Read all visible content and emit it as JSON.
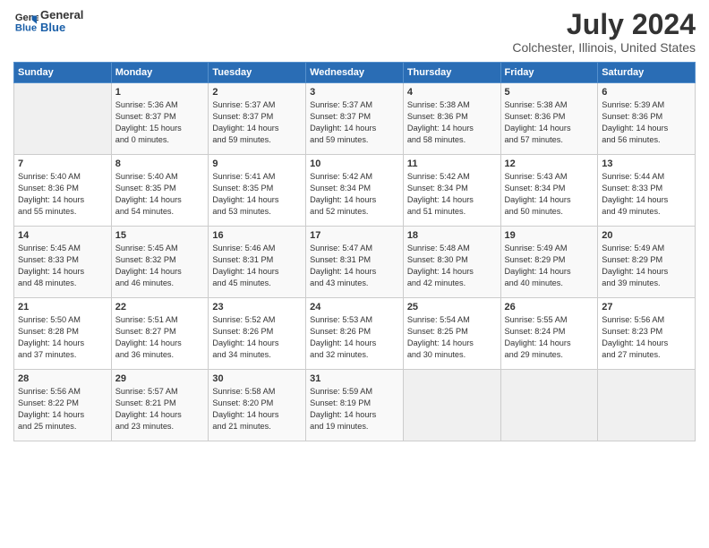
{
  "header": {
    "logo_general": "General",
    "logo_blue": "Blue",
    "title": "July 2024",
    "subtitle": "Colchester, Illinois, United States"
  },
  "days_of_week": [
    "Sunday",
    "Monday",
    "Tuesday",
    "Wednesday",
    "Thursday",
    "Friday",
    "Saturday"
  ],
  "weeks": [
    {
      "days": [
        {
          "number": "",
          "data": ""
        },
        {
          "number": "1",
          "data": "Sunrise: 5:36 AM\nSunset: 8:37 PM\nDaylight: 15 hours\nand 0 minutes."
        },
        {
          "number": "2",
          "data": "Sunrise: 5:37 AM\nSunset: 8:37 PM\nDaylight: 14 hours\nand 59 minutes."
        },
        {
          "number": "3",
          "data": "Sunrise: 5:37 AM\nSunset: 8:37 PM\nDaylight: 14 hours\nand 59 minutes."
        },
        {
          "number": "4",
          "data": "Sunrise: 5:38 AM\nSunset: 8:36 PM\nDaylight: 14 hours\nand 58 minutes."
        },
        {
          "number": "5",
          "data": "Sunrise: 5:38 AM\nSunset: 8:36 PM\nDaylight: 14 hours\nand 57 minutes."
        },
        {
          "number": "6",
          "data": "Sunrise: 5:39 AM\nSunset: 8:36 PM\nDaylight: 14 hours\nand 56 minutes."
        }
      ]
    },
    {
      "days": [
        {
          "number": "7",
          "data": "Sunrise: 5:40 AM\nSunset: 8:36 PM\nDaylight: 14 hours\nand 55 minutes."
        },
        {
          "number": "8",
          "data": "Sunrise: 5:40 AM\nSunset: 8:35 PM\nDaylight: 14 hours\nand 54 minutes."
        },
        {
          "number": "9",
          "data": "Sunrise: 5:41 AM\nSunset: 8:35 PM\nDaylight: 14 hours\nand 53 minutes."
        },
        {
          "number": "10",
          "data": "Sunrise: 5:42 AM\nSunset: 8:34 PM\nDaylight: 14 hours\nand 52 minutes."
        },
        {
          "number": "11",
          "data": "Sunrise: 5:42 AM\nSunset: 8:34 PM\nDaylight: 14 hours\nand 51 minutes."
        },
        {
          "number": "12",
          "data": "Sunrise: 5:43 AM\nSunset: 8:34 PM\nDaylight: 14 hours\nand 50 minutes."
        },
        {
          "number": "13",
          "data": "Sunrise: 5:44 AM\nSunset: 8:33 PM\nDaylight: 14 hours\nand 49 minutes."
        }
      ]
    },
    {
      "days": [
        {
          "number": "14",
          "data": "Sunrise: 5:45 AM\nSunset: 8:33 PM\nDaylight: 14 hours\nand 48 minutes."
        },
        {
          "number": "15",
          "data": "Sunrise: 5:45 AM\nSunset: 8:32 PM\nDaylight: 14 hours\nand 46 minutes."
        },
        {
          "number": "16",
          "data": "Sunrise: 5:46 AM\nSunset: 8:31 PM\nDaylight: 14 hours\nand 45 minutes."
        },
        {
          "number": "17",
          "data": "Sunrise: 5:47 AM\nSunset: 8:31 PM\nDaylight: 14 hours\nand 43 minutes."
        },
        {
          "number": "18",
          "data": "Sunrise: 5:48 AM\nSunset: 8:30 PM\nDaylight: 14 hours\nand 42 minutes."
        },
        {
          "number": "19",
          "data": "Sunrise: 5:49 AM\nSunset: 8:29 PM\nDaylight: 14 hours\nand 40 minutes."
        },
        {
          "number": "20",
          "data": "Sunrise: 5:49 AM\nSunset: 8:29 PM\nDaylight: 14 hours\nand 39 minutes."
        }
      ]
    },
    {
      "days": [
        {
          "number": "21",
          "data": "Sunrise: 5:50 AM\nSunset: 8:28 PM\nDaylight: 14 hours\nand 37 minutes."
        },
        {
          "number": "22",
          "data": "Sunrise: 5:51 AM\nSunset: 8:27 PM\nDaylight: 14 hours\nand 36 minutes."
        },
        {
          "number": "23",
          "data": "Sunrise: 5:52 AM\nSunset: 8:26 PM\nDaylight: 14 hours\nand 34 minutes."
        },
        {
          "number": "24",
          "data": "Sunrise: 5:53 AM\nSunset: 8:26 PM\nDaylight: 14 hours\nand 32 minutes."
        },
        {
          "number": "25",
          "data": "Sunrise: 5:54 AM\nSunset: 8:25 PM\nDaylight: 14 hours\nand 30 minutes."
        },
        {
          "number": "26",
          "data": "Sunrise: 5:55 AM\nSunset: 8:24 PM\nDaylight: 14 hours\nand 29 minutes."
        },
        {
          "number": "27",
          "data": "Sunrise: 5:56 AM\nSunset: 8:23 PM\nDaylight: 14 hours\nand 27 minutes."
        }
      ]
    },
    {
      "days": [
        {
          "number": "28",
          "data": "Sunrise: 5:56 AM\nSunset: 8:22 PM\nDaylight: 14 hours\nand 25 minutes."
        },
        {
          "number": "29",
          "data": "Sunrise: 5:57 AM\nSunset: 8:21 PM\nDaylight: 14 hours\nand 23 minutes."
        },
        {
          "number": "30",
          "data": "Sunrise: 5:58 AM\nSunset: 8:20 PM\nDaylight: 14 hours\nand 21 minutes."
        },
        {
          "number": "31",
          "data": "Sunrise: 5:59 AM\nSunset: 8:19 PM\nDaylight: 14 hours\nand 19 minutes."
        },
        {
          "number": "",
          "data": ""
        },
        {
          "number": "",
          "data": ""
        },
        {
          "number": "",
          "data": ""
        }
      ]
    }
  ]
}
